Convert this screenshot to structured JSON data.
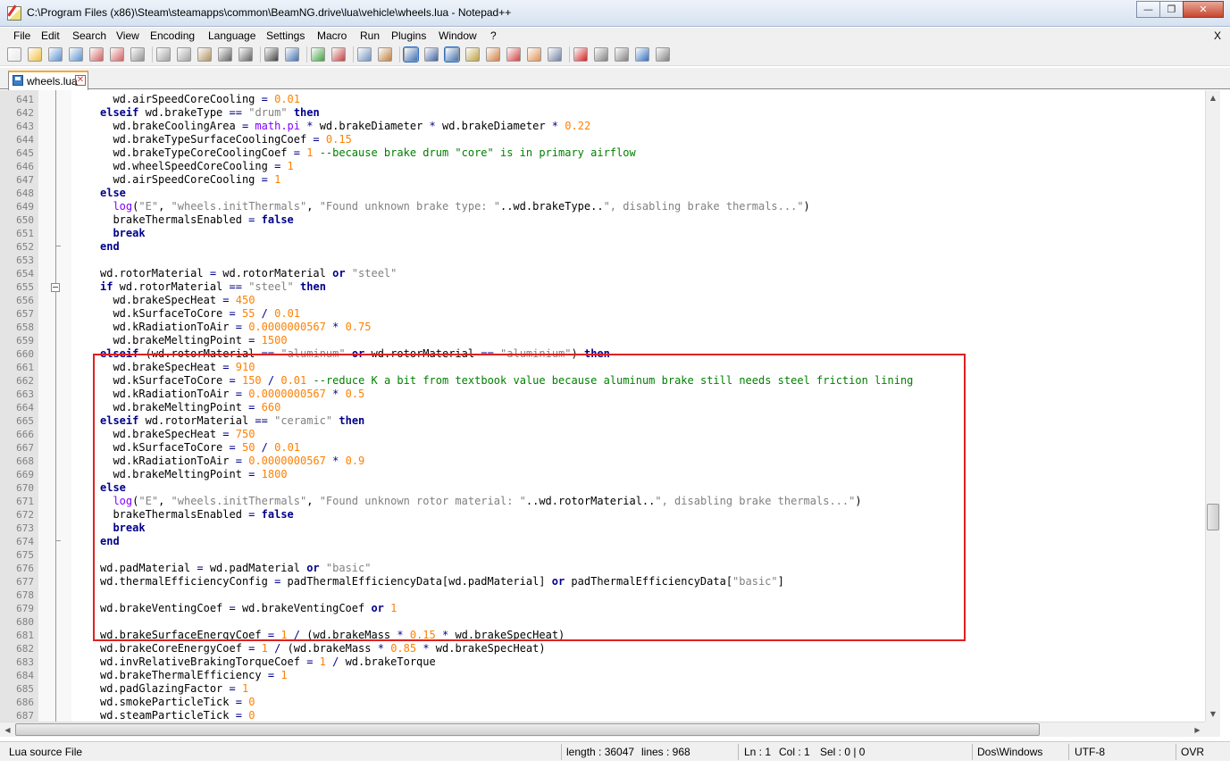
{
  "window": {
    "title": "C:\\Program Files (x86)\\Steam\\steamapps\\common\\BeamNG.drive\\lua\\vehicle\\wheels.lua - Notepad++"
  },
  "menu": [
    {
      "label": "File"
    },
    {
      "label": "Edit"
    },
    {
      "label": "Search"
    },
    {
      "label": "View"
    },
    {
      "label": "Encoding"
    },
    {
      "label": "Language"
    },
    {
      "label": "Settings"
    },
    {
      "label": "Macro"
    },
    {
      "label": "Run"
    },
    {
      "label": "Plugins"
    },
    {
      "label": "Window"
    },
    {
      "label": "?"
    }
  ],
  "menu_close": "X",
  "tab": {
    "label": "wheels.lua"
  },
  "status": {
    "file_type": "Lua source File",
    "length": "length : 36047",
    "lines": "lines : 968",
    "ln": "Ln : 1",
    "col": "Col : 1",
    "sel": "Sel : 0 | 0",
    "eol": "Dos\\Windows",
    "encoding": "UTF-8",
    "mode": "OVR"
  },
  "code_lines": [
    {
      "n": "641",
      "text": "  wd.airSpeedCoreCooling = 0.01"
    },
    {
      "n": "642",
      "text": "elseif wd.brakeType == \"drum\" then"
    },
    {
      "n": "643",
      "text": "  wd.brakeCoolingArea = math.pi * wd.brakeDiameter * wd.brakeDiameter * 0.22"
    },
    {
      "n": "644",
      "text": "  wd.brakeTypeSurfaceCoolingCoef = 0.15"
    },
    {
      "n": "645",
      "text": "  wd.brakeTypeCoreCoolingCoef = 1 --because brake drum \"core\" is in primary airflow"
    },
    {
      "n": "646",
      "text": "  wd.wheelSpeedCoreCooling = 1"
    },
    {
      "n": "647",
      "text": "  wd.airSpeedCoreCooling = 1"
    },
    {
      "n": "648",
      "text": "else"
    },
    {
      "n": "649",
      "text": "  log(\"E\", \"wheels.initThermals\", \"Found unknown brake type: \"..wd.brakeType..\", disabling brake thermals...\")"
    },
    {
      "n": "650",
      "text": "  brakeThermalsEnabled = false"
    },
    {
      "n": "651",
      "text": "  break"
    },
    {
      "n": "652",
      "text": "end"
    },
    {
      "n": "653",
      "text": ""
    },
    {
      "n": "654",
      "text": "wd.rotorMaterial = wd.rotorMaterial or \"steel\""
    },
    {
      "n": "655",
      "text": "if wd.rotorMaterial == \"steel\" then"
    },
    {
      "n": "656",
      "text": "  wd.brakeSpecHeat = 450"
    },
    {
      "n": "657",
      "text": "  wd.kSurfaceToCore = 55 / 0.01"
    },
    {
      "n": "658",
      "text": "  wd.kRadiationToAir = 0.0000000567 * 0.75"
    },
    {
      "n": "659",
      "text": "  wd.brakeMeltingPoint = 1500"
    },
    {
      "n": "660",
      "text": "elseif (wd.rotorMaterial == \"aluminum\" or wd.rotorMaterial == \"aluminium\") then"
    },
    {
      "n": "661",
      "text": "  wd.brakeSpecHeat = 910"
    },
    {
      "n": "662",
      "text": "  wd.kSurfaceToCore = 150 / 0.01 --reduce K a bit from textbook value because aluminum brake still needs steel friction lining"
    },
    {
      "n": "663",
      "text": "  wd.kRadiationToAir = 0.0000000567 * 0.5"
    },
    {
      "n": "664",
      "text": "  wd.brakeMeltingPoint = 660"
    },
    {
      "n": "665",
      "text": "elseif wd.rotorMaterial == \"ceramic\" then"
    },
    {
      "n": "666",
      "text": "  wd.brakeSpecHeat = 750"
    },
    {
      "n": "667",
      "text": "  wd.kSurfaceToCore = 50 / 0.01"
    },
    {
      "n": "668",
      "text": "  wd.kRadiationToAir = 0.0000000567 * 0.9"
    },
    {
      "n": "669",
      "text": "  wd.brakeMeltingPoint = 1800"
    },
    {
      "n": "670",
      "text": "else"
    },
    {
      "n": "671",
      "text": "  log(\"E\", \"wheels.initThermals\", \"Found unknown rotor material: \"..wd.rotorMaterial..\", disabling brake thermals...\")"
    },
    {
      "n": "672",
      "text": "  brakeThermalsEnabled = false"
    },
    {
      "n": "673",
      "text": "  break"
    },
    {
      "n": "674",
      "text": "end"
    },
    {
      "n": "675",
      "text": ""
    },
    {
      "n": "676",
      "text": "wd.padMaterial = wd.padMaterial or \"basic\""
    },
    {
      "n": "677",
      "text": "wd.thermalEfficiencyConfig = padThermalEfficiencyData[wd.padMaterial] or padThermalEfficiencyData[\"basic\"]"
    },
    {
      "n": "678",
      "text": ""
    },
    {
      "n": "679",
      "text": "wd.brakeVentingCoef = wd.brakeVentingCoef or 1"
    },
    {
      "n": "680",
      "text": ""
    },
    {
      "n": "681",
      "text": "wd.brakeSurfaceEnergyCoef = 1 / (wd.brakeMass * 0.15 * wd.brakeSpecHeat)"
    },
    {
      "n": "682",
      "text": "wd.brakeCoreEnergyCoef = 1 / (wd.brakeMass * 0.85 * wd.brakeSpecHeat)"
    },
    {
      "n": "683",
      "text": "wd.invRelativeBrakingTorqueCoef = 1 / wd.brakeTorque"
    },
    {
      "n": "684",
      "text": "wd.brakeThermalEfficiency = 1"
    },
    {
      "n": "685",
      "text": "wd.padGlazingFactor = 1"
    },
    {
      "n": "686",
      "text": "wd.smokeParticleTick = 0"
    },
    {
      "n": "687",
      "text": "wd.steamParticleTick = 0"
    }
  ],
  "fold_marker_lines": [
    "655"
  ],
  "fold_end_lines": [
    "652",
    "674"
  ],
  "toolbar_icons": [
    "new-file-icon",
    "open-file-icon",
    "save-icon",
    "save-all-icon",
    "close-icon",
    "close-all-icon",
    "print-icon",
    "cut-icon",
    "copy-icon",
    "paste-icon",
    "undo-icon",
    "redo-icon",
    "find-icon",
    "replace-icon",
    "zoom-in-icon",
    "zoom-out-icon",
    "sync-vertical-icon",
    "sync-horizontal-icon",
    "word-wrap-icon",
    "show-all-chars-icon",
    "indent-guide-icon",
    "udl-icon",
    "doc-map-icon",
    "function-list-icon",
    "folder-workspace-icon",
    "monitor-icon",
    "record-macro-icon",
    "stop-record-icon",
    "play-macro-icon",
    "run-macro-multiple-icon",
    "save-macro-icon"
  ]
}
